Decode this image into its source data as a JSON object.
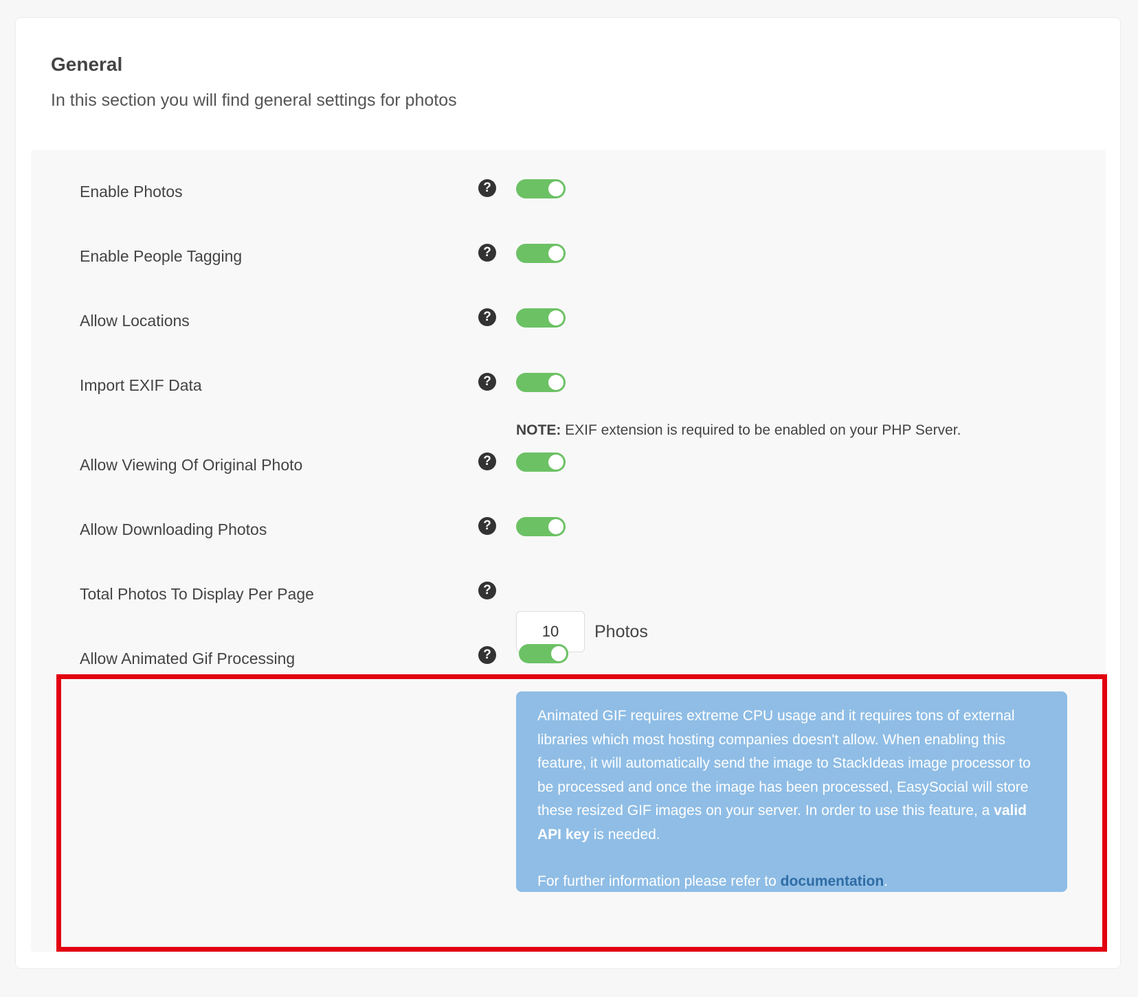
{
  "section": {
    "title": "General",
    "description": "In this section you will find general settings for photos"
  },
  "settings": [
    {
      "label": "Enable Photos",
      "help": "?",
      "enabled": true
    },
    {
      "label": "Enable People Tagging",
      "help": "?",
      "enabled": true
    },
    {
      "label": "Allow Locations",
      "help": "?",
      "enabled": true
    },
    {
      "label": "Import EXIF Data",
      "help": "?",
      "enabled": true
    },
    {
      "label": "Allow Viewing Of Original Photo",
      "help": "?",
      "enabled": true
    },
    {
      "label": "Allow Downloading Photos",
      "help": "?",
      "enabled": true
    },
    {
      "label": "Total Photos To Display Per Page",
      "help": "?",
      "value": "10",
      "unit": "Photos"
    },
    {
      "label": "Allow Animated Gif Processing",
      "help": "?",
      "enabled": true
    }
  ],
  "exif_note": {
    "prefix": "NOTE:",
    "text": " EXIF extension is required to be enabled on your PHP Server."
  },
  "gif_info": {
    "text_before": "Animated GIF requires extreme CPU usage and it requires tons of external libraries which most hosting companies doesn't allow. When enabling this feature, it will automatically send the image to StackIdeas image processor to be processed and once the image has been processed, EasySocial will store these resized GIF images on your server. In order to use this feature, a ",
    "key_text": "valid API key",
    "text_after": " is needed.",
    "doc_prefix": "For further information please refer to ",
    "doc_link": "documentation",
    "doc_suffix": "."
  },
  "colors": {
    "toggle_on": "#6cc164",
    "info_bg": "#8fbde5",
    "highlight": "#e2000f",
    "link": "#2f6ca6"
  },
  "icons": {
    "help": "question-circle-icon"
  }
}
